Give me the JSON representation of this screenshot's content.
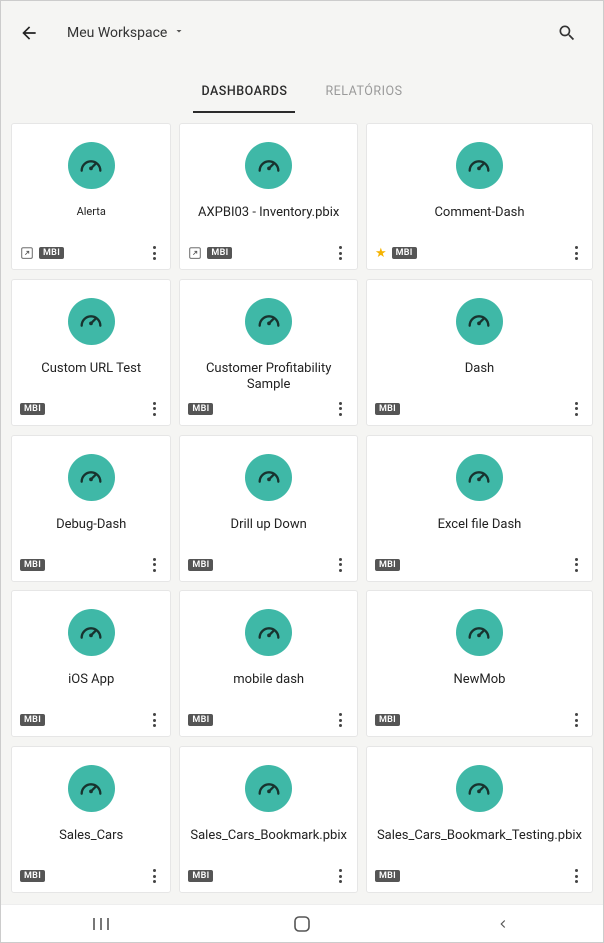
{
  "header": {
    "workspace_label": "Meu Workspace"
  },
  "tabs": {
    "dashboards": "DASHBOARDS",
    "reports": "RELATÓRIOS"
  },
  "badges": {
    "mbi": "MBI"
  },
  "cards": [
    {
      "title": "Alerta",
      "mbi": true,
      "link_icon": true,
      "star": false,
      "small": true
    },
    {
      "title": "AXPBI03 - Inventory.pbix",
      "mbi": true,
      "link_icon": true,
      "star": false,
      "small": false
    },
    {
      "title": "Comment-Dash",
      "mbi": true,
      "link_icon": false,
      "star": true,
      "small": false
    },
    {
      "title": "Custom URL Test",
      "mbi": true,
      "link_icon": false,
      "star": false,
      "small": false
    },
    {
      "title": "Customer Profitability Sample",
      "mbi": true,
      "link_icon": false,
      "star": false,
      "small": false
    },
    {
      "title": "Dash",
      "mbi": true,
      "link_icon": false,
      "star": false,
      "small": false
    },
    {
      "title": "Debug-Dash",
      "mbi": true,
      "link_icon": false,
      "star": false,
      "small": false
    },
    {
      "title": "Drill up Down",
      "mbi": true,
      "link_icon": false,
      "star": false,
      "small": false
    },
    {
      "title": "Excel file Dash",
      "mbi": true,
      "link_icon": false,
      "star": false,
      "small": false
    },
    {
      "title": "iOS App",
      "mbi": true,
      "link_icon": false,
      "star": false,
      "small": false
    },
    {
      "title": "mobile dash",
      "mbi": true,
      "link_icon": false,
      "star": false,
      "small": false
    },
    {
      "title": "NewMob",
      "mbi": true,
      "link_icon": false,
      "star": false,
      "small": false
    },
    {
      "title": "Sales_Cars",
      "mbi": true,
      "link_icon": false,
      "star": false,
      "small": false
    },
    {
      "title": "Sales_Cars_Bookmark.pbix",
      "mbi": true,
      "link_icon": false,
      "star": false,
      "small": false
    },
    {
      "title": "Sales_Cars_Bookmark_Testing.pbix",
      "mbi": true,
      "link_icon": false,
      "star": false,
      "small": false
    }
  ]
}
